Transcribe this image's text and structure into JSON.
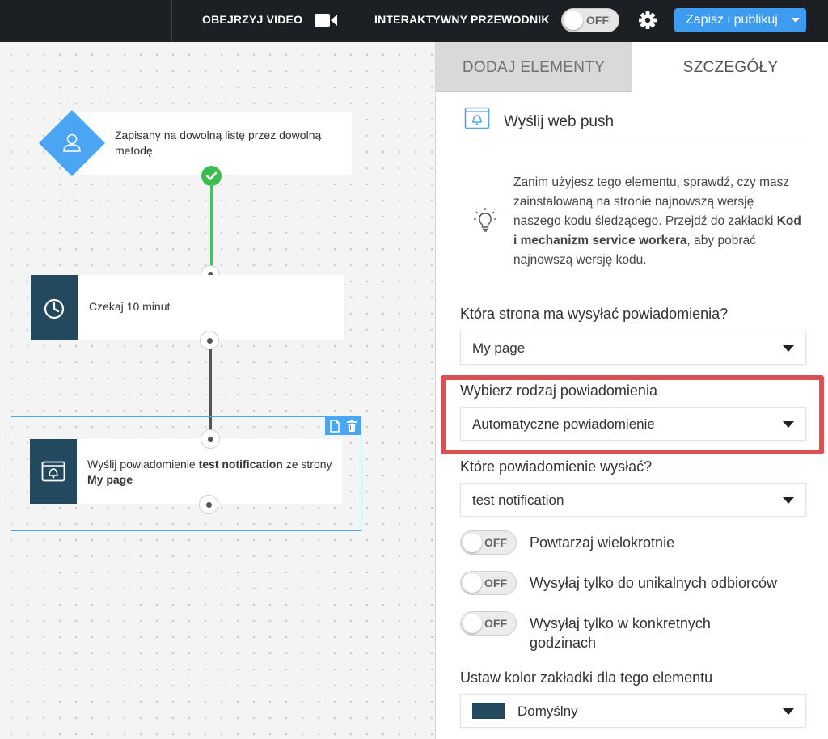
{
  "topbar": {
    "video_link": "OBEJRZYJ VIDEO",
    "guide_label": "INTERAKTYWNY PRZEWODNIK",
    "guide_toggle": "OFF",
    "publish_button": "Zapisz i publikuj"
  },
  "canvas": {
    "trigger_node": {
      "text": "Zapisany na dowolną listę przez dowolną metodę"
    },
    "wait_node": {
      "text": "Czekaj 10 minut"
    },
    "push_node": {
      "prefix": "Wyślij powiadomienie ",
      "notification": "test notification",
      "middle": " ze strony ",
      "page": "My page"
    }
  },
  "panel": {
    "tabs": {
      "add_elements": "DODAJ ELEMENTY",
      "details": "SZCZEGÓŁY"
    },
    "title": "Wyślij web push",
    "info": {
      "text_before": "Zanim użyjesz tego elementu, sprawdź, czy masz zainstalowaną na stronie najnowszą wersję naszego kodu śledzącego. Przejdź do zakładki ",
      "bold": "Kod i mechanizm service workera",
      "text_after": ", aby pobrać najnowszą wersję kodu."
    },
    "page_question": "Która strona ma wysyłać powiadomienia?",
    "page_value": "My page",
    "type_label": "Wybierz rodzaj powiadomienia",
    "type_value": "Automatyczne powiadomienie",
    "which_label": "Które powiadomienie wysłać?",
    "which_value": "test notification",
    "toggles": [
      {
        "label": "Powtarzaj wielokrotnie",
        "state": "OFF"
      },
      {
        "label": "Wysyłaj tylko do unikalnych odbiorców",
        "state": "OFF"
      },
      {
        "label": "Wysyłaj tylko w konkretnych godzinach",
        "state": "OFF"
      }
    ],
    "color_label": "Ustaw kolor zakładki dla tego elementu",
    "color_value": "Domyślny",
    "colors": {
      "accent": "#4aa6f3",
      "node_dark": "#23495f",
      "success": "#3dbb51",
      "highlight": "#d95155",
      "topbar": "#1c1f24"
    }
  }
}
